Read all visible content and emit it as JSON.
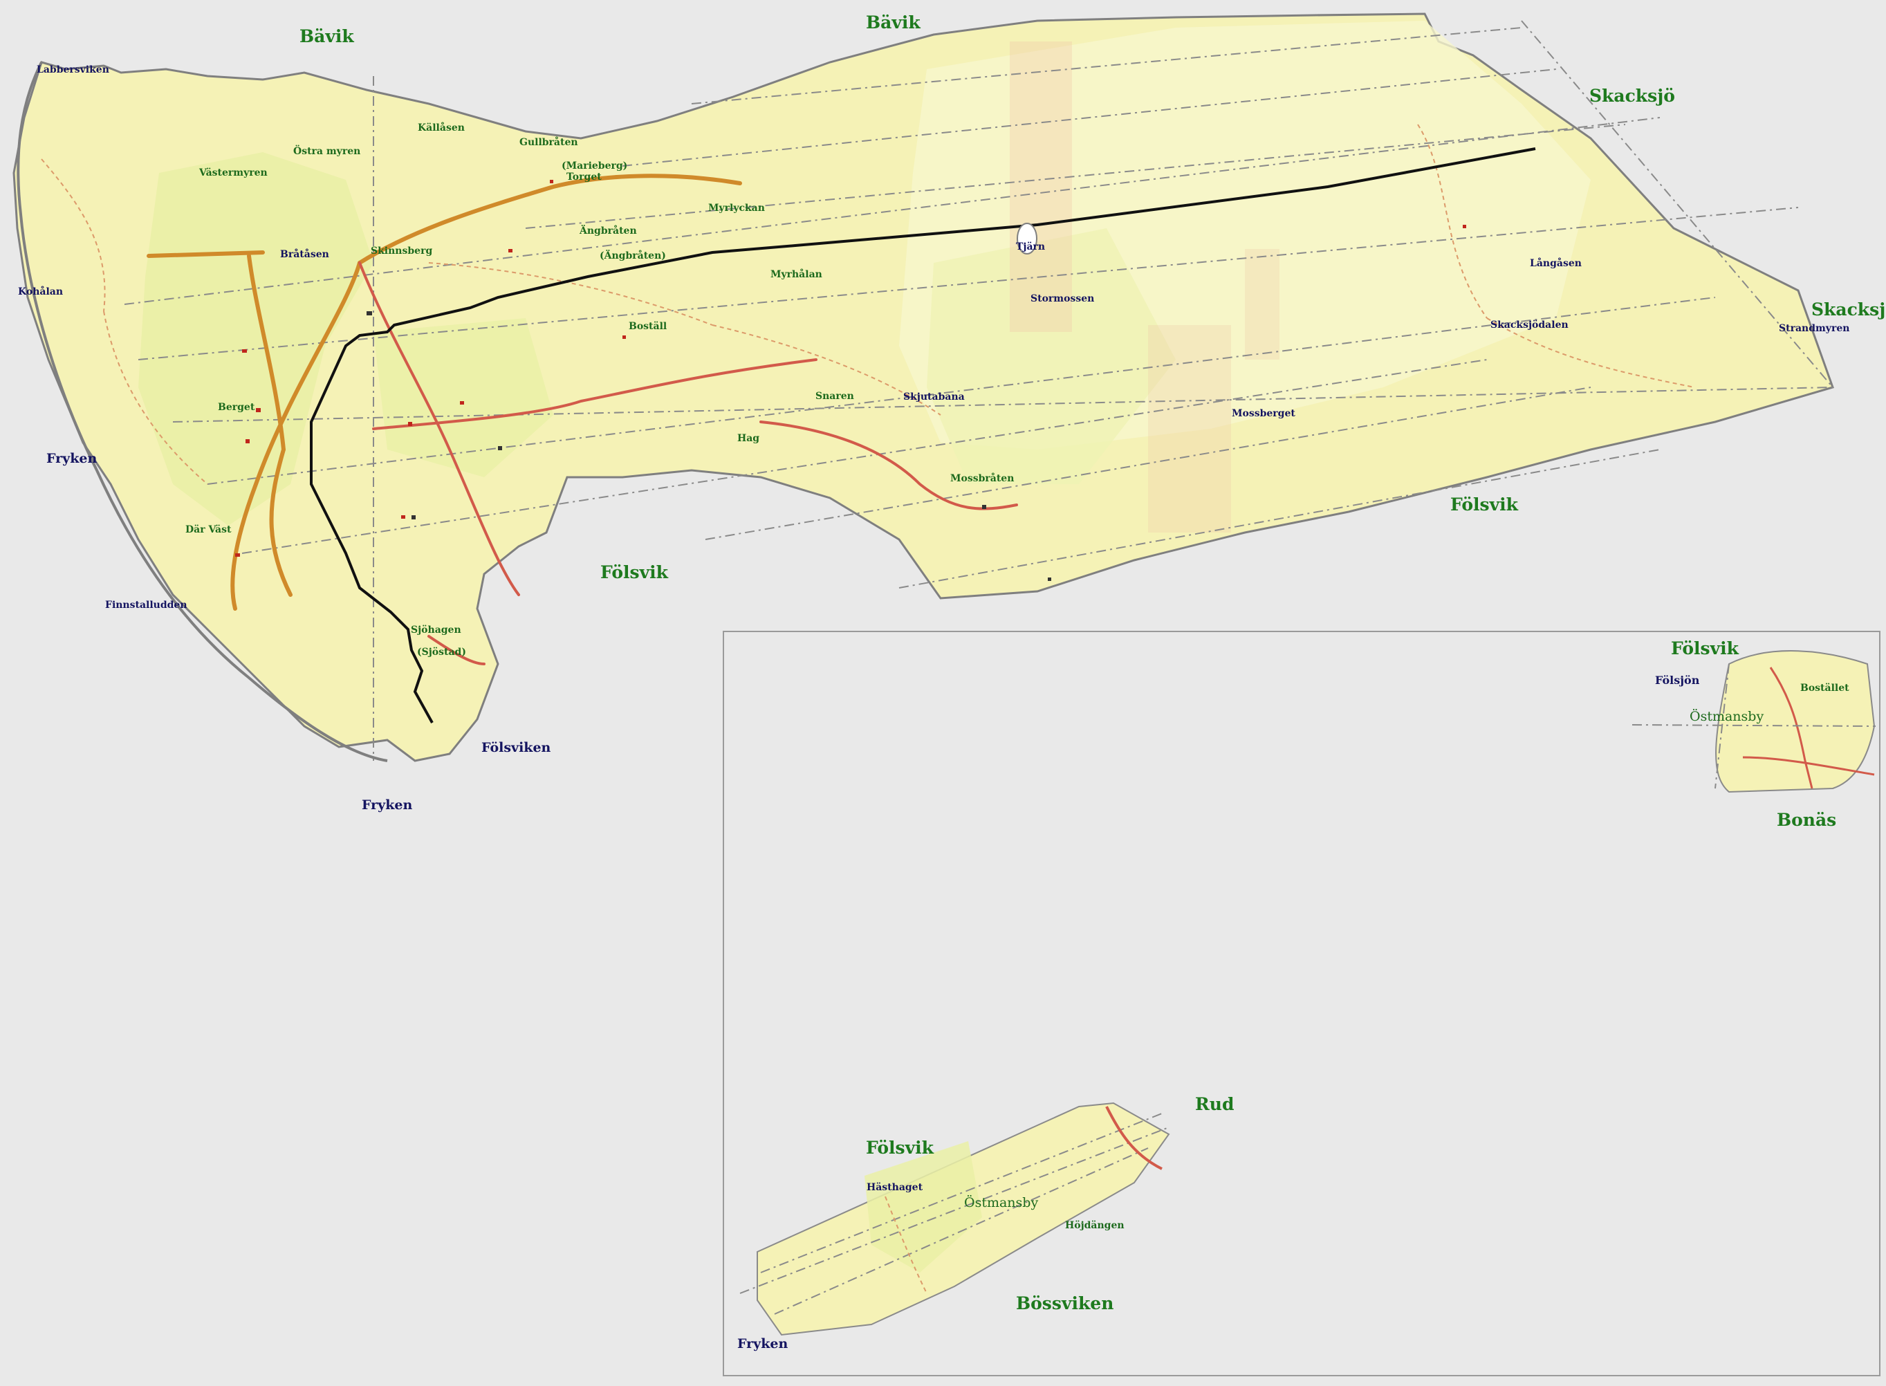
{
  "map": {
    "colors": {
      "background": "#e9e9e9",
      "land": "#f5f2b6",
      "land_light": "#f8f6cd",
      "forest": "#eaf0a6",
      "road_major": "#d08a2a",
      "road_minor": "#dc9a6a",
      "road_red": "#d25a4a",
      "boundary": "#111111",
      "coast": "#7f7f7f",
      "dashed_line": "#8a8a8a",
      "region_text": "#1e7a1e",
      "water_text": "#141460",
      "place_text": "#1d6a1d"
    },
    "labels": {
      "region": [
        {
          "id": "bavik-west",
          "text": "Bävik"
        },
        {
          "id": "bavik-east",
          "text": "Bävik"
        },
        {
          "id": "skacksjo-top",
          "text": "Skacksjö"
        },
        {
          "id": "skacksjo-right",
          "text": "Skacksjö"
        },
        {
          "id": "folsvik-middle",
          "text": "Fölsvik"
        },
        {
          "id": "folsvik-east",
          "text": "Fölsvik"
        },
        {
          "id": "folsvik-inset-top",
          "text": "Fölsvik"
        },
        {
          "id": "bonas",
          "text": "Bonäs"
        },
        {
          "id": "rud",
          "text": "Rud"
        },
        {
          "id": "folsvik-inset-bottom",
          "text": "Fölsvik"
        },
        {
          "id": "bossviken",
          "text": "Bössviken"
        }
      ],
      "water": [
        {
          "id": "fryken-west",
          "text": "Fryken"
        },
        {
          "id": "fryken-south",
          "text": "Fryken"
        },
        {
          "id": "folsviken",
          "text": "Fölsviken"
        },
        {
          "id": "fryken-inset",
          "text": "Fryken"
        },
        {
          "id": "folsjon",
          "text": "Fölsjön"
        }
      ],
      "place": [
        {
          "id": "kallasen",
          "text": "Källåsen"
        },
        {
          "id": "gullbraten",
          "text": "Gullbråten"
        },
        {
          "id": "ostra-myren",
          "text": "Östra myren"
        },
        {
          "id": "vastermyren",
          "text": "Västermyren"
        },
        {
          "id": "marieberg",
          "text": "(Marieberg)"
        },
        {
          "id": "torget",
          "text": "Torget"
        },
        {
          "id": "myrlyckan",
          "text": "Myrlyckan"
        },
        {
          "id": "angbraten",
          "text": "Ängbråten"
        },
        {
          "id": "angbraten-paren",
          "text": "(Ängbråten)"
        },
        {
          "id": "skinnsberg",
          "text": "Skinnsberg"
        },
        {
          "id": "myrhalan",
          "text": "Myrhålan"
        },
        {
          "id": "bostall",
          "text": "Boställ"
        },
        {
          "id": "snaren",
          "text": "Snaren"
        },
        {
          "id": "hag",
          "text": "Hag"
        },
        {
          "id": "mossbraten",
          "text": "Mossbråten"
        },
        {
          "id": "berget",
          "text": "Berget"
        },
        {
          "id": "dar-vast",
          "text": "Där Väst"
        },
        {
          "id": "sjohagen",
          "text": "Sjöhagen"
        },
        {
          "id": "sjostad",
          "text": "(Sjöstad)"
        },
        {
          "id": "bostallet",
          "text": "Bostället"
        },
        {
          "id": "hojdangen",
          "text": "Höjdängen"
        }
      ],
      "field": [
        {
          "id": "labbersviken",
          "text": "Labbersviken"
        },
        {
          "id": "kohalan",
          "text": "Kohålan"
        },
        {
          "id": "bratasen",
          "text": "Bråtåsen"
        },
        {
          "id": "finnstalludden",
          "text": "Finnstalludden"
        },
        {
          "id": "tjarn",
          "text": "Tjärn"
        },
        {
          "id": "stormossen",
          "text": "Stormossen"
        },
        {
          "id": "skjutabana",
          "text": "Skjutabana"
        },
        {
          "id": "mossberget",
          "text": "Mossberget"
        },
        {
          "id": "langasen",
          "text": "Långåsen"
        },
        {
          "id": "skacksjodalen",
          "text": "Skacksjödalen"
        },
        {
          "id": "strandmyren",
          "text": "Strandmyren"
        },
        {
          "id": "hasthaget",
          "text": "Hästhaget"
        }
      ],
      "plain": [
        {
          "id": "ostmansby-top",
          "text": "Östmansby"
        },
        {
          "id": "ostmansby-bottom",
          "text": "Östmansby"
        }
      ]
    }
  }
}
